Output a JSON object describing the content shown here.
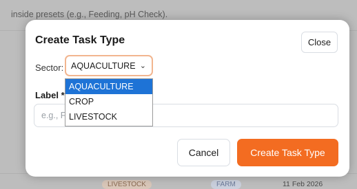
{
  "background": {
    "hint_text": "inside presets (e.g., Feeding, pH Check).",
    "row_badges": [
      "LIVESTOCK",
      "FARM"
    ],
    "row_date": "11 Feb 2026"
  },
  "modal": {
    "title": "Create Task Type",
    "close_label": "Close",
    "sector": {
      "label": "Sector:",
      "selected": "AQUACULTURE",
      "options": [
        "AQUACULTURE",
        "CROP",
        "LIVESTOCK"
      ]
    },
    "label_field": {
      "label": "Label *",
      "placeholder": "e.g., Feeding",
      "value": ""
    },
    "cancel_label": "Cancel",
    "submit_label": "Create Task Type"
  },
  "colors": {
    "accent": "#f36c21",
    "select_focus": "#f2b58f",
    "option_highlight": "#1e73d6"
  }
}
